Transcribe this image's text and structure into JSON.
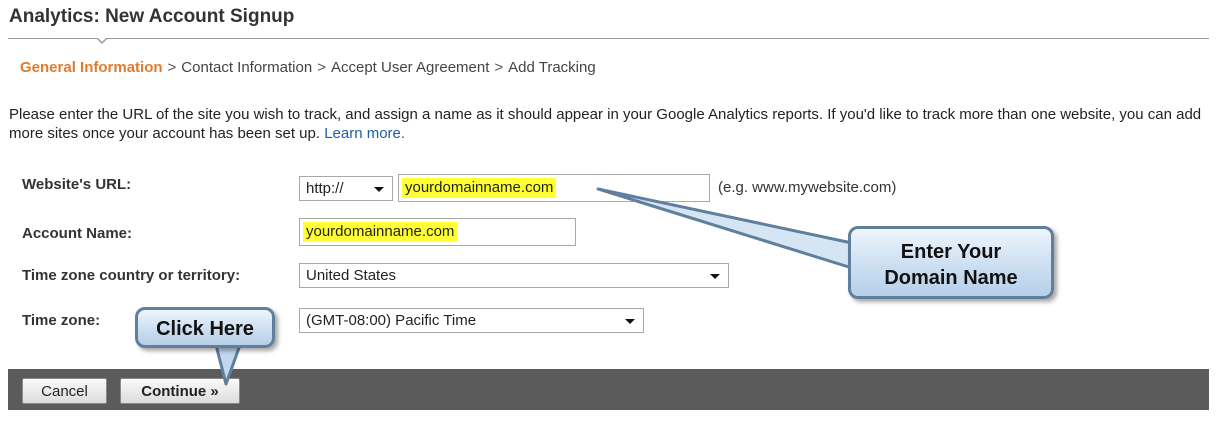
{
  "header": {
    "title": "Analytics: New Account Signup"
  },
  "breadcrumb": {
    "steps": [
      "General Information",
      "Contact Information",
      "Accept User Agreement",
      "Add Tracking"
    ],
    "separator": ">"
  },
  "intro": {
    "text": "Please enter the URL of the site you wish to track, and assign a name as it should appear in your Google Analytics reports. If you'd like to track more than one website, you can add more sites once your account has been set up.",
    "link_text": "Learn more."
  },
  "form": {
    "website_url": {
      "label": "Website's URL:",
      "protocol": "http://",
      "value": "yourdomainname.com",
      "hint": "(e.g. www.mywebsite.com)"
    },
    "account_name": {
      "label": "Account Name:",
      "value": "yourdomainname.com"
    },
    "country": {
      "label": "Time zone country or territory:",
      "value": "United States"
    },
    "timezone": {
      "label": "Time zone:",
      "value": "(GMT-08:00) Pacific Time"
    }
  },
  "actions": {
    "cancel_label": "Cancel",
    "continue_label": "Continue »"
  },
  "callouts": {
    "domain_line1": "Enter Your",
    "domain_line2": "Domain Name",
    "click_here": "Click Here"
  },
  "colors": {
    "active_step": "#e07b2f",
    "link": "#1f5fa8",
    "highlight": "#ffff33",
    "button_bar": "#5b5b5b",
    "callout_border": "#5f7f9d"
  }
}
